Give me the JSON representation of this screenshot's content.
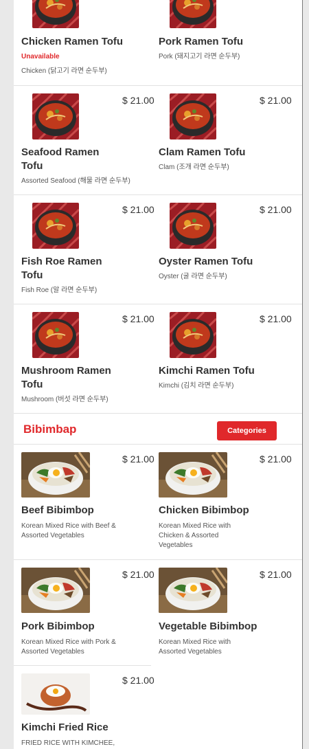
{
  "tofu": {
    "items": [
      {
        "name": "Chicken Ramen Tofu",
        "status": "Unavailable",
        "desc": "Chicken (닭고기 라면 순두부)"
      },
      {
        "name": "Pork Ramen Tofu",
        "desc": "Pork (돼지고기 라면 순두부)"
      },
      {
        "name": "Seafood Ramen Tofu",
        "price": "$ 21.00",
        "desc": "Assorted Seafood (해물 라면 순두부)"
      },
      {
        "name": "Clam Ramen Tofu",
        "price": "$ 21.00",
        "desc": "Clam (조개 라면 순두부)"
      },
      {
        "name": "Fish Roe Ramen Tofu",
        "price": "$ 21.00",
        "desc": "Fish Roe (알 라면 순두부)"
      },
      {
        "name": "Oyster Ramen Tofu",
        "price": "$ 21.00",
        "desc": "Oyster (굴 라면 순두부)"
      },
      {
        "name": "Mushroom Ramen Tofu",
        "price": "$ 21.00",
        "desc": "Mushroom (버섯 라면 순두부)"
      },
      {
        "name": "Kimchi Ramen Tofu",
        "price": "$ 21.00",
        "desc": "Kimchi (김치 라면 순두부)"
      }
    ]
  },
  "bibimbap": {
    "title": "Bibimbap",
    "categories_button": "Categories",
    "items": [
      {
        "name": "Beef Bibimbop",
        "price": "$ 21.00",
        "desc": "Korean Mixed Rice with Beef & Assorted Vegetables"
      },
      {
        "name": "Chicken Bibimbop",
        "price": "$ 21.00",
        "desc": "Korean Mixed Rice with Chicken & Assorted Vegetables"
      },
      {
        "name": "Pork Bibimbop",
        "price": "$ 21.00",
        "desc": "Korean Mixed Rice with Pork & Assorted Vegetables"
      },
      {
        "name": "Vegetable Bibimbop",
        "price": "$ 21.00",
        "desc": "Korean Mixed Rice with Assorted Vegetables"
      },
      {
        "name": "Kimchi Fried Rice",
        "price": "$ 21.00",
        "desc": "FRIED RICE WITH KIMCHEE,"
      }
    ]
  }
}
